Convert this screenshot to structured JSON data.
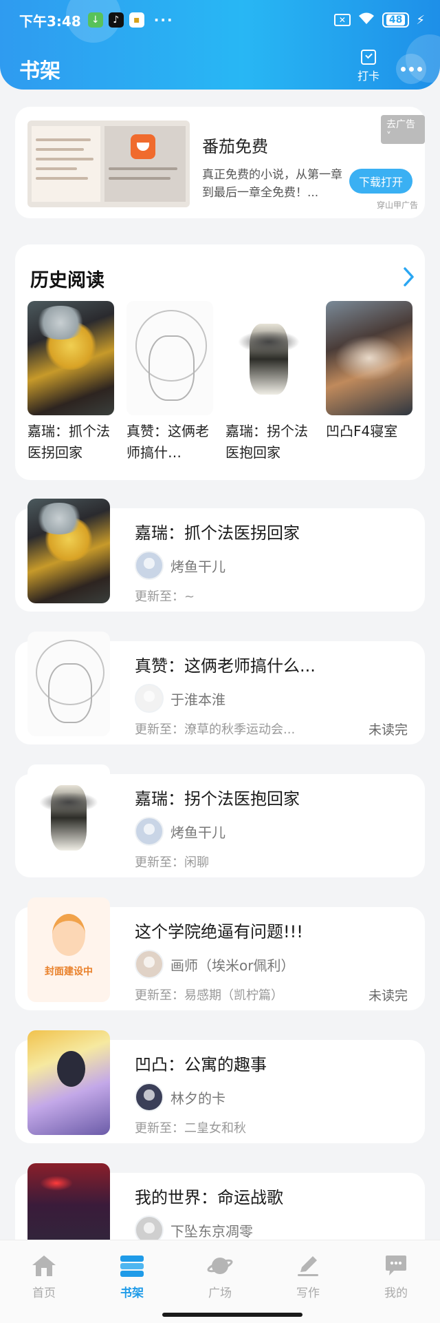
{
  "status_bar": {
    "time": "下午3:48",
    "dots": "···",
    "battery": "48"
  },
  "header": {
    "title": "书架",
    "checkin_label": "打卡"
  },
  "ad": {
    "title": "番茄免费",
    "description": "真正免费的小说，从第一章到最后一章全免费！...",
    "button": "下载打开",
    "tag": "去广告",
    "source": "穿山甲广告"
  },
  "history": {
    "title": "历史阅读",
    "items": [
      {
        "name": "嘉瑞：抓个法医拐回家"
      },
      {
        "name": "真赞：这俩老师搞什…"
      },
      {
        "name": "嘉瑞：拐个法医抱回家"
      },
      {
        "name": "凹凸F4寝室"
      }
    ]
  },
  "books": [
    {
      "title": "嘉瑞：抓个法医拐回家",
      "author": "烤鱼干儿",
      "update": "更新至：~",
      "status": ""
    },
    {
      "title": "真赞：这俩老师搞什么...",
      "author": "于淮本淮",
      "update": "更新至：潦草的秋季运动会...",
      "status": "未读完"
    },
    {
      "title": "嘉瑞：拐个法医抱回家",
      "author": "烤鱼干儿",
      "update": "更新至：闲聊",
      "status": ""
    },
    {
      "title": "这个学院绝逼有问题!!!",
      "author": "画师（埃米or佩利）",
      "update": "更新至：易感期（凯柠篇）",
      "status": "未读完",
      "cover_text": "封面建设中"
    },
    {
      "title": "凹凸：公寓的趣事",
      "author": "林夕的卡",
      "update": "更新至：二皇女和秋",
      "status": ""
    },
    {
      "title": "我的世界：命运战歌",
      "author": "下坠东京凋零",
      "update": "",
      "status": ""
    }
  ],
  "bottom_nav": {
    "items": [
      {
        "label": "首页",
        "icon": "home-icon"
      },
      {
        "label": "书架",
        "icon": "bookshelf-icon",
        "active": true
      },
      {
        "label": "广场",
        "icon": "planet-icon"
      },
      {
        "label": "写作",
        "icon": "write-icon"
      },
      {
        "label": "我的",
        "icon": "chat-bubble-icon"
      }
    ]
  },
  "colors": {
    "accent": "#2aa6f2",
    "active_nav": "#1f9be8"
  }
}
